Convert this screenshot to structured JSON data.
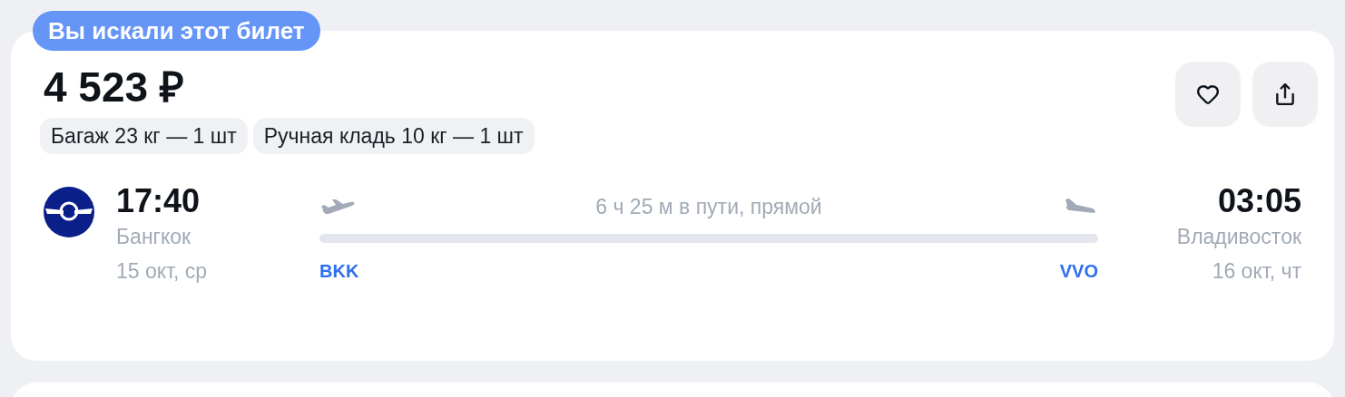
{
  "badge": "Вы искали этот билет",
  "price": "4 523 ₽",
  "baggage": [
    "Багаж 23 кг — 1 шт",
    "Ручная кладь 10 кг — 1 шт"
  ],
  "favorite": {
    "selected": false
  },
  "departure": {
    "time": "17:40",
    "city": "Бангкок",
    "date": "15 окт, ср",
    "code": "BKK"
  },
  "duration": "6 ч 25 м в пути, прямой",
  "arrival": {
    "time": "03:05",
    "city": "Владивосток",
    "date": "16 окт, чт",
    "code": "VVO"
  }
}
